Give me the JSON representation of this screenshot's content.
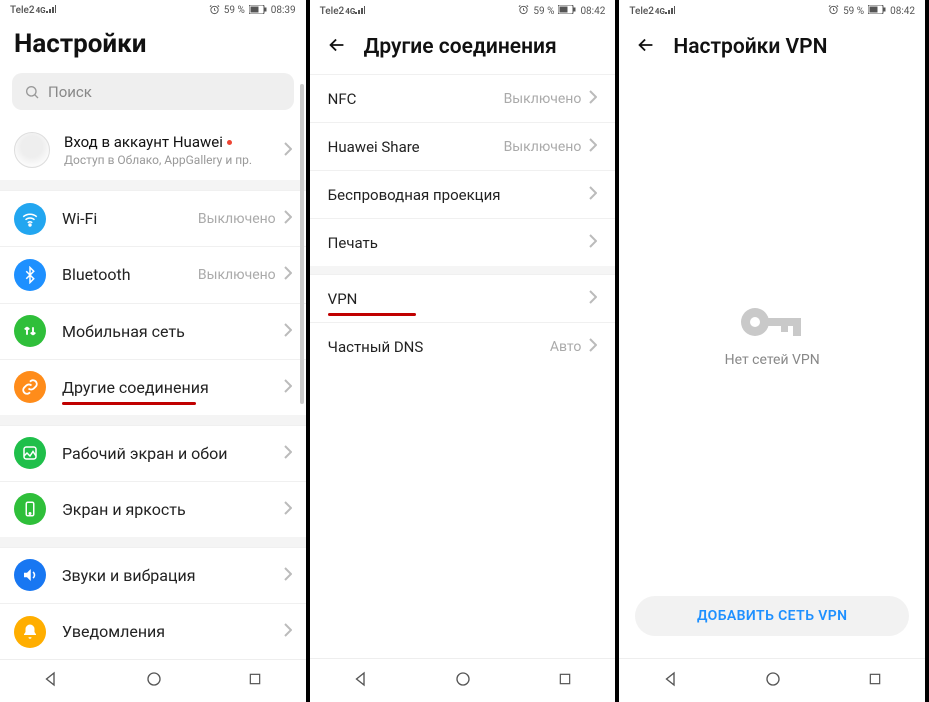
{
  "status": {
    "carrier": "Tele2",
    "battery_pct": "59 %",
    "pane1_time": "08:39",
    "pane2_time": "08:42",
    "pane3_time": "08:42",
    "alarm_icon": "alarm-icon",
    "battery_icon": "battery-icon"
  },
  "pane1": {
    "title": "Настройки",
    "search_placeholder": "Поиск",
    "account": {
      "line1": "Вход в аккаунт Huawei",
      "line2": "Доступ в Облако, AppGallery и пр."
    },
    "groups": [
      {
        "items": [
          {
            "icon": "wifi-icon",
            "icon_color": "#22a6f0",
            "label": "Wi-Fi",
            "value": "Выключено"
          },
          {
            "icon": "bluetooth-icon",
            "icon_color": "#1e90ff",
            "label": "Bluetooth",
            "value": "Выключено"
          },
          {
            "icon": "mobile-data-icon",
            "icon_color": "#2fbf3a",
            "label": "Мобильная сеть",
            "value": ""
          },
          {
            "icon": "link-icon",
            "icon_color": "#ff8c1a",
            "label": "Другие соединения",
            "value": "",
            "underline": true
          }
        ]
      },
      {
        "items": [
          {
            "icon": "wallpaper-icon",
            "icon_color": "#1fbf4a",
            "label": "Рабочий экран и обои",
            "value": ""
          },
          {
            "icon": "display-icon",
            "icon_color": "#2fbf3a",
            "label": "Экран и яркость",
            "value": ""
          }
        ]
      },
      {
        "items": [
          {
            "icon": "sound-icon",
            "icon_color": "#1877f2",
            "label": "Звуки и вибрация",
            "value": ""
          },
          {
            "icon": "notification-icon",
            "icon_color": "#ffae00",
            "label": "Уведомления",
            "value": ""
          }
        ]
      }
    ]
  },
  "pane2": {
    "title": "Другие соединения",
    "items_top": [
      {
        "label": "NFC",
        "value": "Выключено"
      },
      {
        "label": "Huawei Share",
        "value": "Выключено"
      },
      {
        "label": "Беспроводная проекция",
        "value": ""
      },
      {
        "label": "Печать",
        "value": ""
      }
    ],
    "items_bottom": [
      {
        "label": "VPN",
        "value": "",
        "underline": true
      },
      {
        "label": "Частный DNS",
        "value": "Авто"
      }
    ]
  },
  "pane3": {
    "title": "Настройки VPN",
    "empty_msg": "Нет сетей VPN",
    "add_button": "ДОБАВИТЬ СЕТЬ VPN"
  }
}
